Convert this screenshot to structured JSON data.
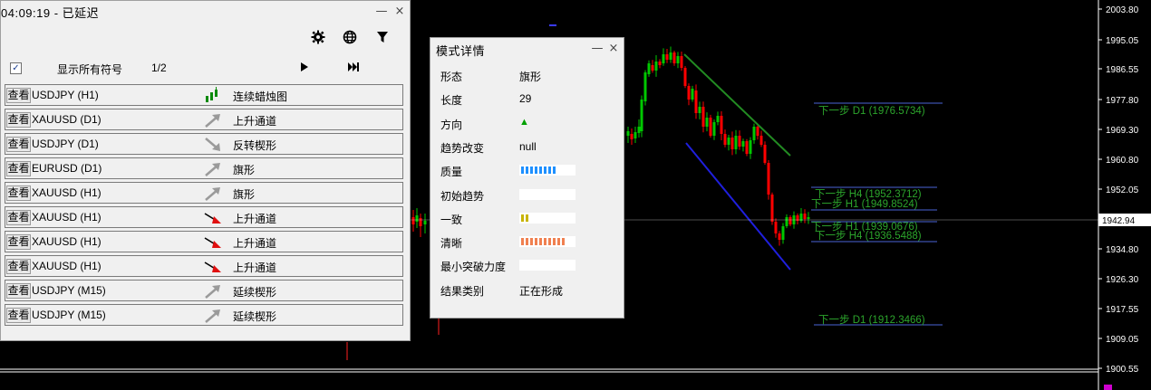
{
  "price_axis": {
    "labels": [
      "2003.80",
      "1995.05",
      "1986.55",
      "1977.80",
      "1969.30",
      "1960.80",
      "1952.05",
      "1942.94",
      "1934.80",
      "1926.30",
      "1917.55",
      "1909.05",
      "1900.55"
    ],
    "current_price": "1942.94"
  },
  "projection_levels": [
    {
      "label": "下一步 D1 (1976.5734)"
    },
    {
      "label": "下一步 H4 (1952.3712)"
    },
    {
      "label": "下一步 H1 (1949.8524)"
    },
    {
      "label": "下一步 H1 (1939.0676)"
    },
    {
      "label": "下一步 H4 (1936.5488)"
    },
    {
      "label": "下一步 D1 (1912.3466)"
    }
  ],
  "list_panel": {
    "title": "04:09:19 - 已延迟",
    "minimize_glyph": "—",
    "close_glyph": "×",
    "show_all_label": "显示所有符号",
    "page_indicator": "1/2",
    "rows": [
      {
        "button": "查看",
        "symbol": "USDJPY (H1)",
        "pattern": "连续蜡烛图",
        "icon": "candles-icon"
      },
      {
        "button": "查看",
        "symbol": "XAUUSD (D1)",
        "pattern": "上升通道",
        "icon": "arrow-up-gray-icon"
      },
      {
        "button": "查看",
        "symbol": "USDJPY (D1)",
        "pattern": "反转楔形",
        "icon": "arrow-down-gray-icon"
      },
      {
        "button": "查看",
        "symbol": "EURUSD (D1)",
        "pattern": "旗形",
        "icon": "arrow-up-gray-icon"
      },
      {
        "button": "查看",
        "symbol": "XAUUSD (H1)",
        "pattern": "旗形",
        "icon": "arrow-up-gray-icon"
      },
      {
        "button": "查看",
        "symbol": "XAUUSD (H1)",
        "pattern": "上升通道",
        "icon": "arrow-down-red-icon"
      },
      {
        "button": "查看",
        "symbol": "XAUUSD (H1)",
        "pattern": "上升通道",
        "icon": "arrow-down-red-icon"
      },
      {
        "button": "查看",
        "symbol": "XAUUSD (H1)",
        "pattern": "上升通道",
        "icon": "arrow-down-red-icon"
      },
      {
        "button": "查看",
        "symbol": "USDJPY (M15)",
        "pattern": "延续楔形",
        "icon": "arrow-up-gray-icon"
      },
      {
        "button": "查看",
        "symbol": "USDJPY (M15)",
        "pattern": "延续楔形",
        "icon": "arrow-up-gray-icon"
      }
    ]
  },
  "detail_panel": {
    "title": "模式详情",
    "minimize_glyph": "—",
    "close_glyph": "×",
    "rows": [
      {
        "label": "形态",
        "value": "旗形"
      },
      {
        "label": "长度",
        "value": "29"
      },
      {
        "label": "方向",
        "value": "▲"
      },
      {
        "label": "趋势改变",
        "value": "null"
      },
      {
        "label": "质量",
        "value": ""
      },
      {
        "label": "初始趋势",
        "value": ""
      },
      {
        "label": "一致",
        "value": ""
      },
      {
        "label": "清晰",
        "value": ""
      },
      {
        "label": "最小突破力度",
        "value": ""
      },
      {
        "label": "结果类别",
        "value": "正在形成"
      }
    ],
    "meters": {
      "quality": {
        "fraction": 0.8,
        "color": "#1e90ff"
      },
      "initial_trend": {
        "fraction": 0.0,
        "color": "#1e90ff"
      },
      "consistency": {
        "fraction": 0.2,
        "color": "#c8b400"
      },
      "clarity": {
        "fraction": 1.0,
        "color": "#f08050"
      },
      "min_breakout": {
        "fraction": 0.0,
        "color": "#1e90ff"
      }
    }
  },
  "colors": {
    "bull": "#00c800",
    "bear": "#ff0000",
    "upper_line": "#228b22",
    "lower_line": "#1f1fdd",
    "level_line": "#4a63d6",
    "direction_up": "#00a000"
  }
}
